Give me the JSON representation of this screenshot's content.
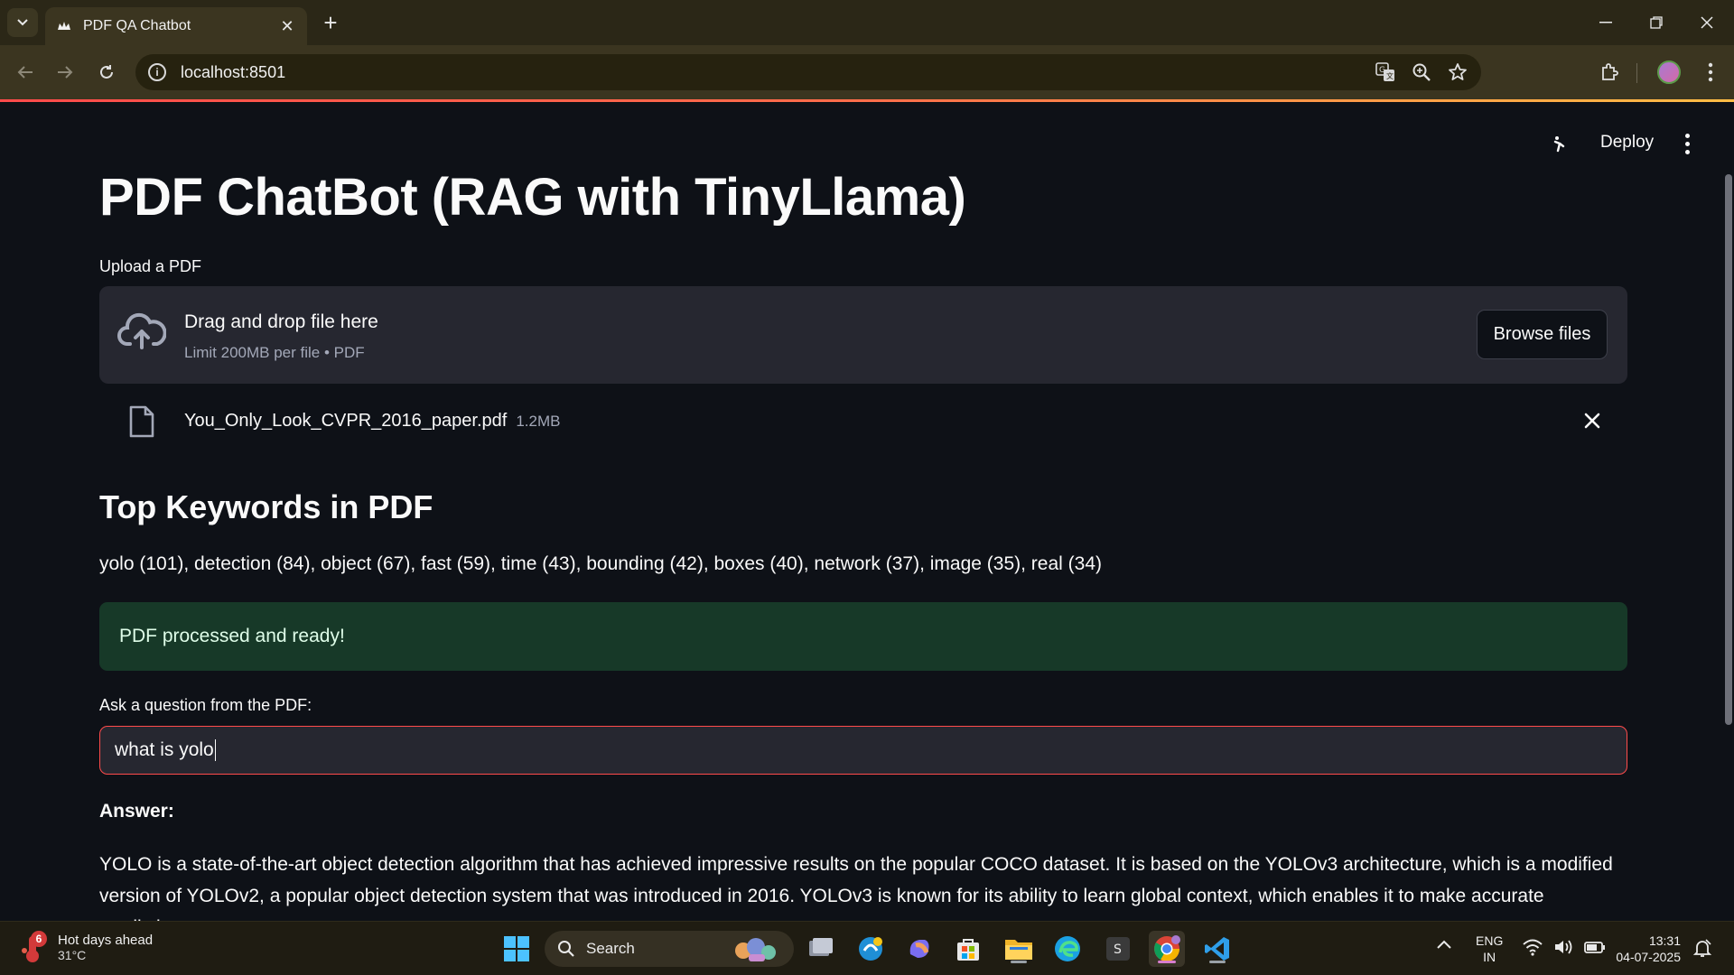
{
  "browser": {
    "tab_title": "PDF QA Chatbot",
    "url": "localhost:8501"
  },
  "app": {
    "header": {
      "deploy_label": "Deploy"
    },
    "title": "PDF ChatBot (RAG with TinyLlama)",
    "upload": {
      "label": "Upload a PDF",
      "drop_text": "Drag and drop file here",
      "limit_text": "Limit 200MB per file • PDF",
      "browse_label": "Browse files"
    },
    "file": {
      "name": "You_Only_Look_CVPR_2016_paper.pdf",
      "size": "1.2MB"
    },
    "keywords": {
      "heading": "Top Keywords in PDF",
      "text": "yolo (101), detection (84), object (67), fast (59), time (43), bounding (42), boxes (40), network (37), image (35), real (34)"
    },
    "status": {
      "success": "PDF processed and ready!"
    },
    "question": {
      "label": "Ask a question from the PDF:",
      "value": "what is yolo"
    },
    "answer": {
      "label": "Answer:",
      "text": "YOLO is a state-of-the-art object detection algorithm that has achieved impressive results on the popular COCO dataset. It is based on the YOLOv3 architecture, which is a modified version of YOLOv2, a popular object detection system that was introduced in 2016. YOLOv3 is known for its ability to learn global context, which enables it to make accurate predictions"
    }
  },
  "taskbar": {
    "weather_badge": "6",
    "weather_title": "Hot days ahead",
    "weather_temp": "31°C",
    "search_label": "Search",
    "lang_line1": "ENG",
    "lang_line2": "IN",
    "time": "13:31",
    "date": "04-07-2025"
  },
  "colors": {
    "accent": "#ff4b4b",
    "success_bg": "#173928",
    "app_bg": "#0e1117",
    "panel_bg": "#262730"
  }
}
